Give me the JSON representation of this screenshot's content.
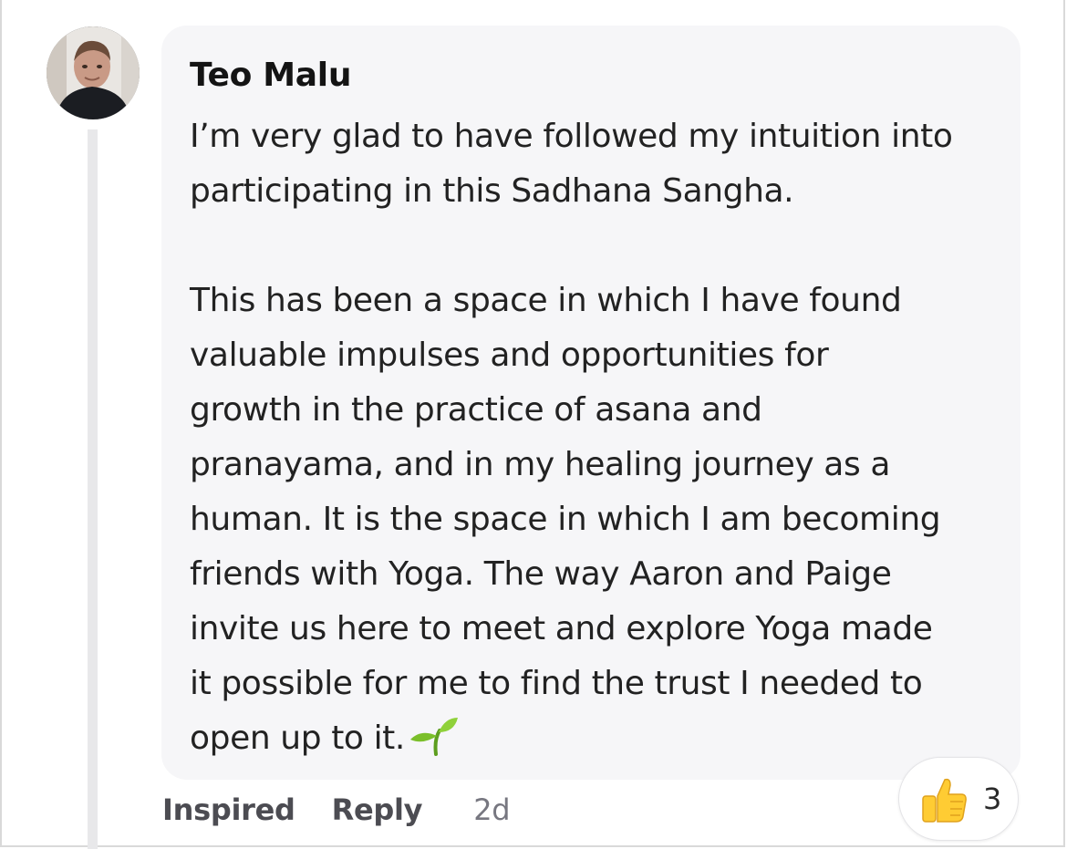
{
  "comment": {
    "author": "Teo Malu",
    "body": {
      "paragraph1": [
        "I’m very glad to have followed my intuition into",
        "participating in this Sadhana Sangha."
      ],
      "paragraph2": [
        "This has been a space in which I have found",
        "valuable impulses and opportunities for",
        "growth in the practice of asana and",
        "pranayama, and in my healing journey as a",
        "human. It is the space in which I am becoming",
        "friends with Yoga. The way Aaron and Paige",
        "invite us here to meet and explore Yoga made",
        "it possible for me to find the trust I needed to",
        "open up to it."
      ],
      "trailing_emoji": "seedling-icon"
    }
  },
  "actions": {
    "inspired_label": "Inspired",
    "reply_label": "Reply",
    "timestamp": "2d"
  },
  "reaction": {
    "icon": "thumbs-up-icon",
    "count": "3"
  },
  "colors": {
    "bubble_bg": "#f6f6f8",
    "thread_line": "#e8e8ea",
    "action_text": "#4c4c52",
    "timestamp_text": "#777780",
    "thumb_yellow": "#ffcc33",
    "sprout_green": "#7bbf2a"
  }
}
